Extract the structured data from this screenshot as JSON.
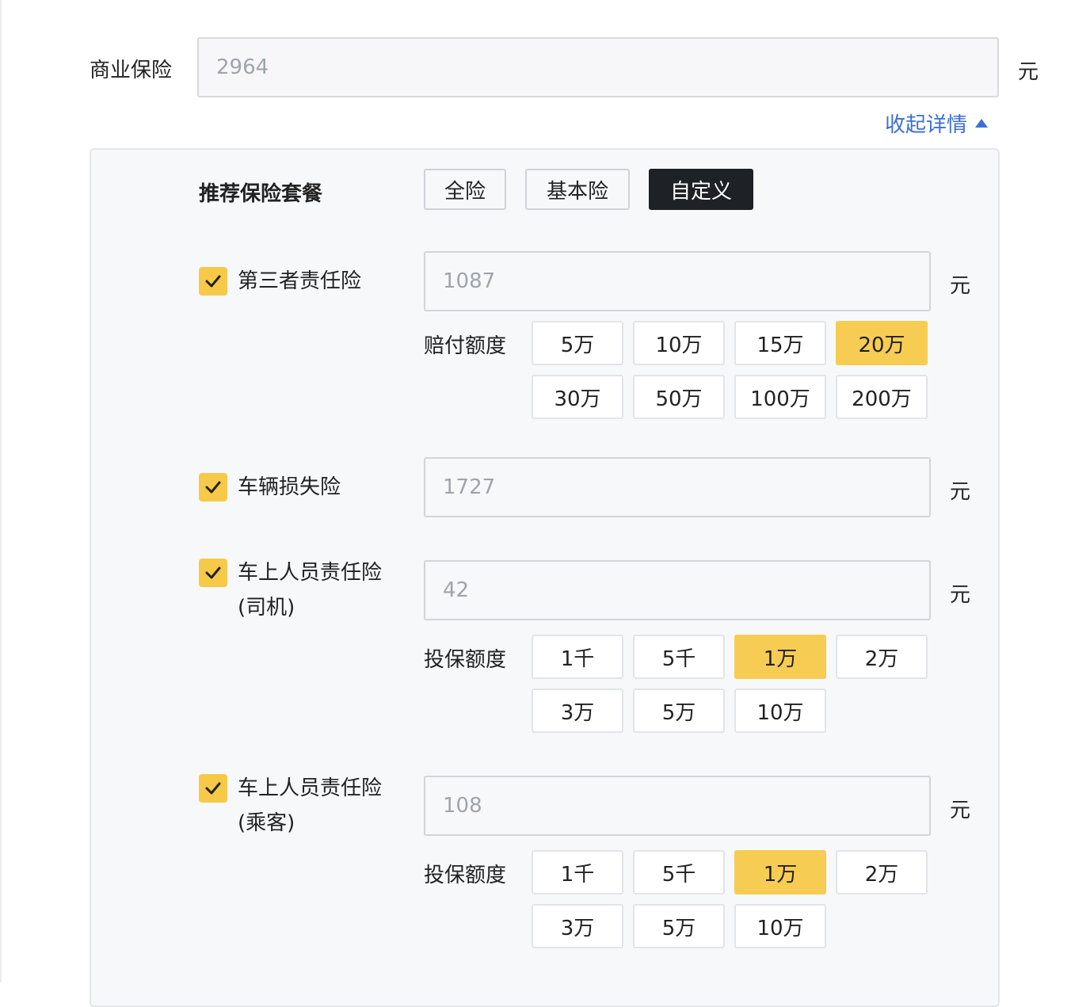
{
  "commercial": {
    "label": "商业保险",
    "value": "2964",
    "unit": "元",
    "collapse_text": "收起详情"
  },
  "packages": {
    "label": "推荐保险套餐",
    "buttons": [
      "全险",
      "基本险",
      "自定义"
    ],
    "active": "自定义"
  },
  "items": [
    {
      "name": "第三者责任险",
      "name_line2": "",
      "checked": true,
      "value": "1087",
      "unit": "元",
      "option_label": "赔付额度",
      "options": [
        "5万",
        "10万",
        "15万",
        "20万",
        "30万",
        "50万",
        "100万",
        "200万"
      ],
      "selected": "20万"
    },
    {
      "name": "车辆损失险",
      "name_line2": "",
      "checked": true,
      "value": "1727",
      "unit": "元",
      "option_label": "",
      "options": [],
      "selected": ""
    },
    {
      "name": "车上人员责任险",
      "name_line2": "(司机)",
      "checked": true,
      "value": "42",
      "unit": "元",
      "option_label": "投保额度",
      "options": [
        "1千",
        "5千",
        "1万",
        "2万",
        "3万",
        "5万",
        "10万"
      ],
      "selected": "1万"
    },
    {
      "name": "车上人员责任险",
      "name_line2": "(乘客)",
      "checked": true,
      "value": "108",
      "unit": "元",
      "option_label": "投保额度",
      "options": [
        "1千",
        "5千",
        "1万",
        "2万",
        "3万",
        "5万",
        "10万"
      ],
      "selected": "1万"
    }
  ],
  "colors": {
    "accent": "#f7cc52",
    "link": "#3b6fd6",
    "active_dark": "#1e2126"
  }
}
